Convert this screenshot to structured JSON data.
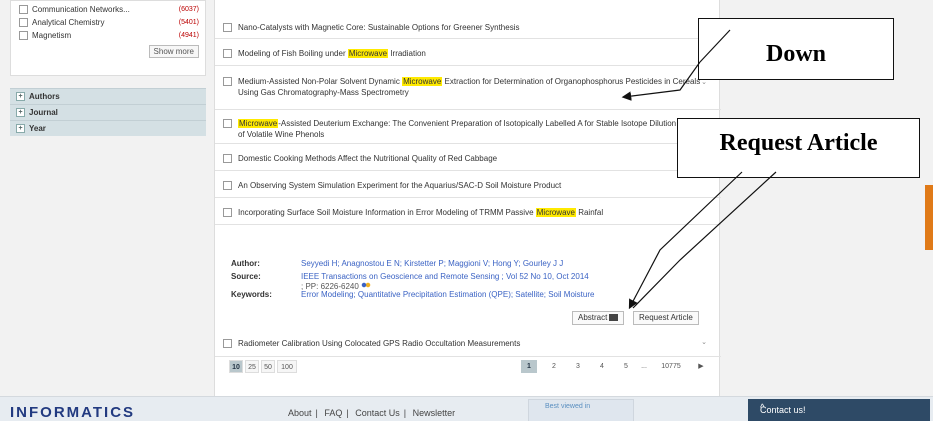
{
  "sidebar": {
    "facets": [
      {
        "label": "Communication Networks...",
        "count": "(6037)"
      },
      {
        "label": "Analytical Chemistry",
        "count": "(5401)"
      },
      {
        "label": "Magnetism",
        "count": "(4941)"
      }
    ],
    "show_more": "Show more",
    "groups": [
      "Authors",
      "Journal",
      "Year"
    ],
    "plus_glyph": "+"
  },
  "results": [
    {
      "parts": [
        {
          "t": "Nano-Catalysts with Magnetic Core: Sustainable Options for Greener Synthesis",
          "hl": false
        }
      ]
    },
    {
      "parts": [
        {
          "t": "Modeling of Fish Boiling under ",
          "hl": false
        },
        {
          "t": "Microwave",
          "hl": true
        },
        {
          "t": " Irradiation",
          "hl": false
        }
      ]
    },
    {
      "parts": [
        {
          "t": "Medium-Assisted Non-Polar Solvent Dynamic ",
          "hl": false
        },
        {
          "t": "Microwave",
          "hl": true
        },
        {
          "t": " Extraction for Determination of Organophosphorus Pesticides in Cereals Using Gas Chromatography-Mass Spectrometry",
          "hl": false
        }
      ]
    },
    {
      "parts": [
        {
          "t": "Microwave",
          "hl": true
        },
        {
          "t": "-Assisted Deuterium Exchange: The Convenient Preparation of Isotopically Labelled A",
          "hl": false
        },
        {
          "t": " for Stable Isotope Dilution Analysis of Volatile Wine Phenols",
          "hl": false
        }
      ]
    },
    {
      "parts": [
        {
          "t": "Domestic Cooking Methods Affect the Nutritional Quality of Red Cabbage",
          "hl": false
        }
      ]
    },
    {
      "parts": [
        {
          "t": "An Observing System Simulation Experiment for the Aquarius/SAC-D Soil Moisture Product",
          "hl": false
        }
      ]
    },
    {
      "parts": [
        {
          "t": "Incorporating Surface Soil Moisture Information in Error Modeling of TRMM Passive ",
          "hl": false
        },
        {
          "t": "Microwave",
          "hl": true
        },
        {
          "t": " Rainfal",
          "hl": false
        }
      ]
    },
    {
      "parts": [
        {
          "t": "Radiometer Calibration Using Colocated GPS Radio Occultation Measurements",
          "hl": false
        }
      ]
    }
  ],
  "details": {
    "author_label": "Author:",
    "author_value": "Seyyedi H; Anagnostou E N; Kirstetter P; Maggioni V; Hong Y; Gourley J J",
    "source_label": "Source:",
    "source_value": "IEEE Transactions on Geoscience and Remote Sensing ; Vol 52 No 10, Oct 2014",
    "source_pages": "; PP: 6226-6240",
    "keywords_label": "Keywords:",
    "keywords_value": "Error Modeling; Quantitative Precipitation Estimation (QPE); Satellite; Soil Moisture",
    "abstract_button": "Abstract",
    "request_button": "Request Article"
  },
  "pager": {
    "sizes": [
      "10",
      "25",
      "50",
      "100"
    ],
    "pages": [
      "1",
      "2",
      "3",
      "4",
      "5",
      "...",
      "10775"
    ],
    "next": "▶",
    "chevron": "⌄"
  },
  "footer": {
    "logo": "INFORMATICS",
    "links": [
      "About",
      "FAQ",
      "Contact Us",
      "Newsletter"
    ],
    "separator": "|",
    "best_viewed": "Best viewed in",
    "contact": "Contact us!",
    "contact_caret": "^"
  },
  "annotations": {
    "down": "Down",
    "request_article": "Request Article"
  },
  "colors": {
    "highlight": "#ffea00",
    "link": "#3b63c4",
    "count": "#b00000",
    "accent_tab": "#e07a18",
    "footer_contact": "#2e4a66"
  }
}
